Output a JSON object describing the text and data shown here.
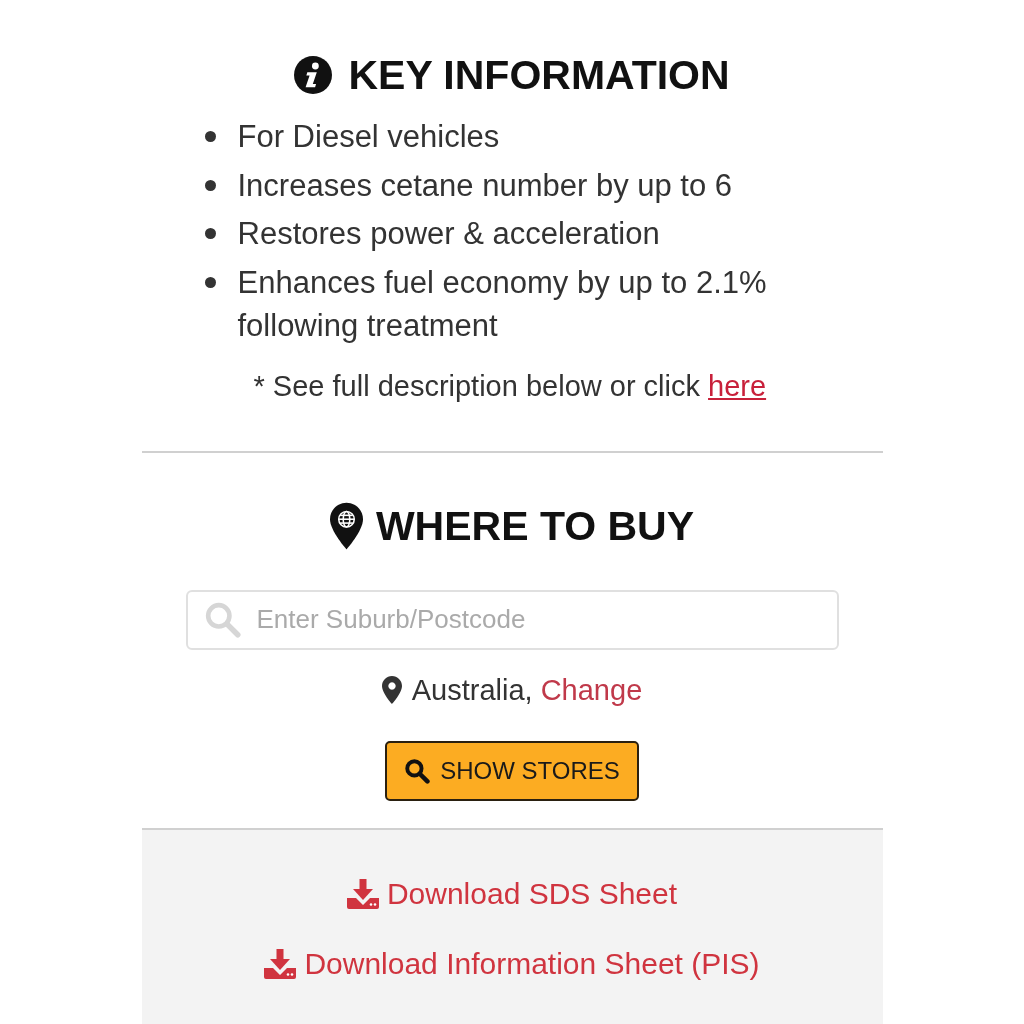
{
  "key_information": {
    "title": "KEY INFORMATION",
    "bullets": [
      "For Diesel vehicles",
      "Increases cetane number by up to 6",
      "Restores power & acceleration",
      "Enhances fuel economy by up to 2.1% following treatment"
    ],
    "note": {
      "text": "* See full description below or click ",
      "link": "here"
    }
  },
  "where_to_buy": {
    "title": "WHERE TO BUY",
    "search": {
      "placeholder": "Enter Suburb/Postcode"
    },
    "location": {
      "text": "Australia, ",
      "link": "Change"
    },
    "button": "SHOW STORES"
  },
  "downloads": [
    "Download SDS Sheet",
    "Download Information Sheet (PIS)"
  ]
}
